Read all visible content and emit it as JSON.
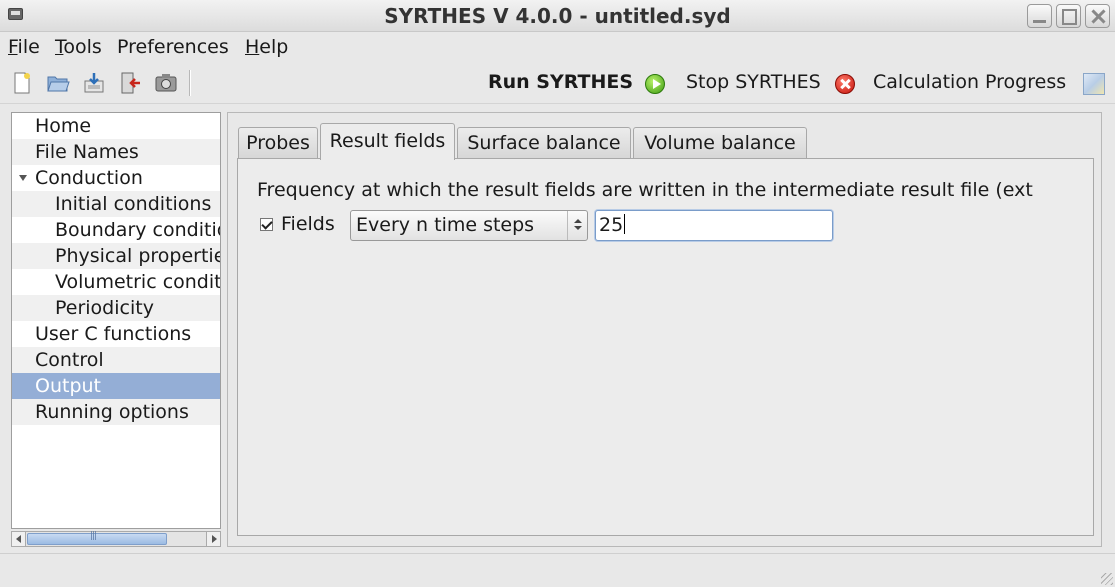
{
  "window": {
    "title": "SYRTHES V 4.0.0 - untitled.syd"
  },
  "menubar": [
    {
      "label": "File",
      "mnemonic": "F",
      "rest": "ile"
    },
    {
      "label": "Tools",
      "mnemonic": "T",
      "rest": "ools"
    },
    {
      "label": "Preferences",
      "mnemonic": "",
      "rest": "Preferences"
    },
    {
      "label": "Help",
      "mnemonic": "H",
      "rest": "elp"
    }
  ],
  "toolbar": {
    "icons": [
      "new-file-icon",
      "open-folder-icon",
      "save-icon",
      "exit-icon",
      "screenshot-icon"
    ],
    "run_label": "Run SYRTHES",
    "stop_label": "Stop SYRTHES",
    "progress_label": "Calculation Progress"
  },
  "tree": {
    "items": [
      {
        "label": "Home",
        "level": 0
      },
      {
        "label": "File Names",
        "level": 0
      },
      {
        "label": "Conduction",
        "level": 0,
        "expanded": true
      },
      {
        "label": "Initial conditions",
        "level": 1
      },
      {
        "label": "Boundary conditions",
        "level": 1
      },
      {
        "label": "Physical properties",
        "level": 1
      },
      {
        "label": "Volumetric conditions",
        "level": 1
      },
      {
        "label": "Periodicity",
        "level": 1
      },
      {
        "label": "User C functions",
        "level": 0
      },
      {
        "label": "Control",
        "level": 0
      },
      {
        "label": "Output",
        "level": 0,
        "selected": true
      },
      {
        "label": "Running options",
        "level": 0
      }
    ]
  },
  "tabs": [
    {
      "label": "Probes",
      "active": false
    },
    {
      "label": "Result fields",
      "active": true
    },
    {
      "label": "Surface balance",
      "active": false
    },
    {
      "label": "Volume balance",
      "active": false
    }
  ],
  "result_fields": {
    "description": "Frequency at which the result fields are written in the intermediate result file (ext",
    "checkbox_label": "Fields",
    "checkbox_checked": true,
    "frequency_mode": "Every n time steps",
    "frequency_value": "25"
  },
  "colors": {
    "selection": "#94aed6",
    "run_icon": "#3d9b12",
    "stop_icon": "#c4120a"
  }
}
